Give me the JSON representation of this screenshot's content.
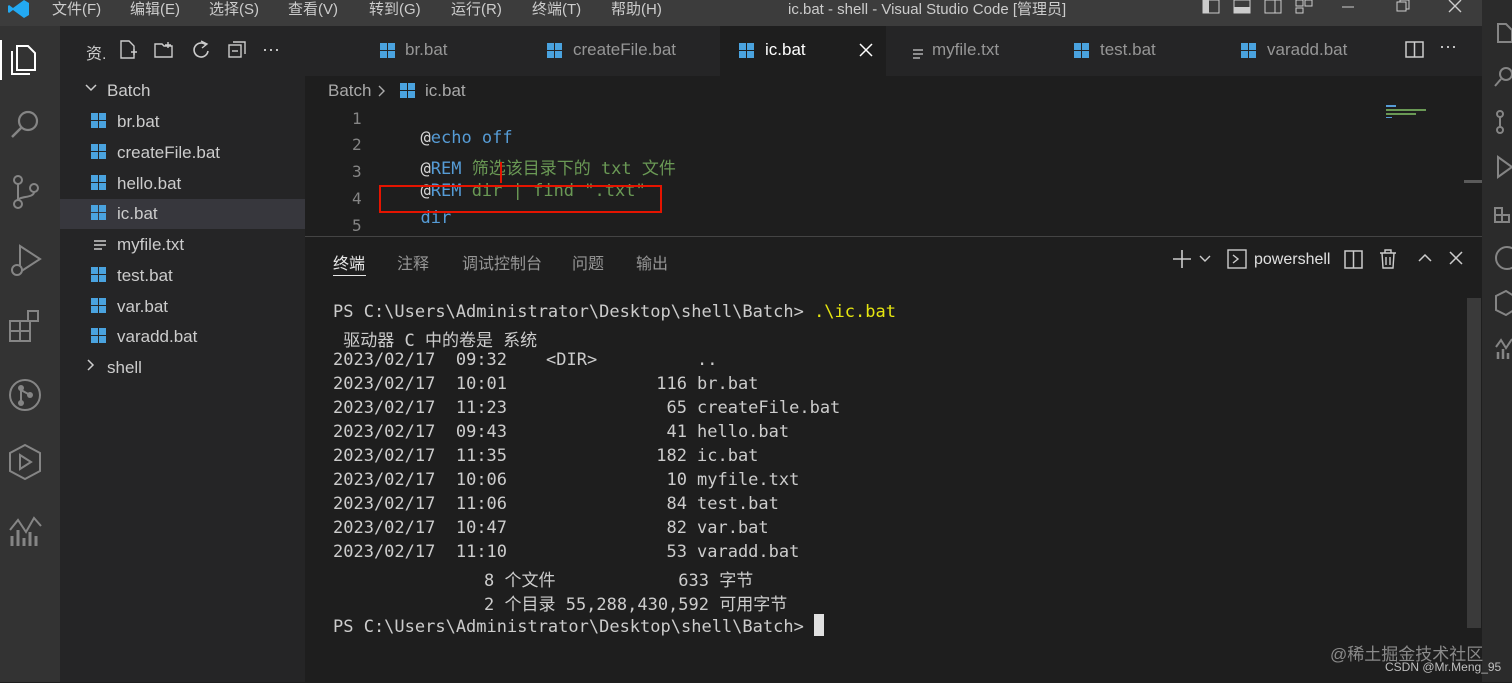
{
  "menu": [
    "文件(F)",
    "编辑(E)",
    "选择(S)",
    "查看(V)",
    "转到(G)",
    "运行(R)",
    "终端(T)",
    "帮助(H)"
  ],
  "window_title": "ic.bat - shell - Visual Studio Code [管理员]",
  "sidebar": {
    "header_label": "资.",
    "folder": "Batch",
    "files": [
      "br.bat",
      "createFile.bat",
      "hello.bat",
      "ic.bat",
      "myfile.txt",
      "test.bat",
      "var.bat",
      "varadd.bat"
    ],
    "collapsed_folder": "shell"
  },
  "tabs": [
    "br.bat",
    "createFile.bat",
    "ic.bat",
    "myfile.txt",
    "test.bat",
    "varadd.bat"
  ],
  "breadcrumb": {
    "folder": "Batch",
    "file": "ic.bat"
  },
  "editor": {
    "line_numbers": [
      "1",
      "2",
      "3",
      "4",
      "5"
    ],
    "lines": [
      {
        "at": "@",
        "kw": "echo",
        "rest": " off"
      },
      {
        "at": "@",
        "kw": "REM",
        "rest": " 筛选该目录下的 txt 文件"
      },
      {
        "at": "@",
        "kw": "REM",
        "rest": " dir | find \".txt\""
      },
      {
        "at": "",
        "kw": "dir",
        "rest": ""
      }
    ]
  },
  "panel": {
    "tabs": [
      "终端",
      "注释",
      "调试控制台",
      "问题",
      "输出"
    ],
    "terminal_name": "powershell"
  },
  "terminal": {
    "prompt": "PS C:\\Users\\Administrator\\Desktop\\shell\\Batch>",
    "command": ".\\ic.bat",
    "volume_line": " 驱动器 C 中的卷是 系统",
    "entries": [
      {
        "date": "2023/02/17",
        "time": "09:32",
        "size": "<DIR>",
        "name": ".."
      },
      {
        "date": "2023/02/17",
        "time": "10:01",
        "size": "116",
        "name": "br.bat"
      },
      {
        "date": "2023/02/17",
        "time": "11:23",
        "size": "65",
        "name": "createFile.bat"
      },
      {
        "date": "2023/02/17",
        "time": "09:43",
        "size": "41",
        "name": "hello.bat"
      },
      {
        "date": "2023/02/17",
        "time": "11:35",
        "size": "182",
        "name": "ic.bat"
      },
      {
        "date": "2023/02/17",
        "time": "10:06",
        "size": "10",
        "name": "myfile.txt"
      },
      {
        "date": "2023/02/17",
        "time": "11:06",
        "size": "84",
        "name": "test.bat"
      },
      {
        "date": "2023/02/17",
        "time": "10:47",
        "size": "82",
        "name": "var.bat"
      },
      {
        "date": "2023/02/17",
        "time": "11:10",
        "size": "53",
        "name": "varadd.bat"
      }
    ],
    "summary_files": "8 个文件            633 字节",
    "summary_dirs": "2 个目录 55,288,430,592 可用字节"
  },
  "watermark": {
    "line1": "@稀土掘金技术社区",
    "line2": "CSDN @Mr.Meng_95"
  },
  "colors": {
    "keyword": "#569cd6",
    "comment": "#6a9955",
    "string": "#ce9178",
    "highlight_box": "#e51400",
    "command": "#e5e510"
  }
}
